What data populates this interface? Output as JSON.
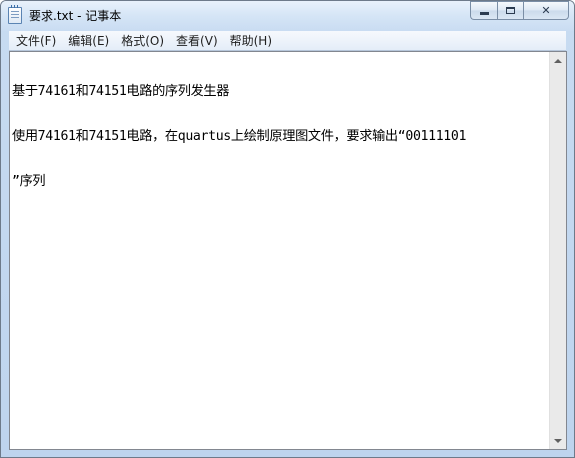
{
  "window": {
    "title": "要求.txt - 记事本",
    "icon": "notepad-icon",
    "controls": {
      "minimize": "minimize-icon",
      "maximize": "maximize-icon",
      "close": "close-icon",
      "close_glyph": "✕"
    }
  },
  "menu": {
    "items": [
      {
        "label": "文件(F)"
      },
      {
        "label": "编辑(E)"
      },
      {
        "label": "格式(O)"
      },
      {
        "label": "查看(V)"
      },
      {
        "label": "帮助(H)"
      }
    ]
  },
  "document": {
    "lines": [
      "基于74161和74151电路的序列发生器",
      "使用74161和74151电路，在quartus上绘制原理图文件，要求输出“00111101",
      "”序列"
    ]
  },
  "scrollbar": {
    "up_icon": "scroll-up-arrow-icon",
    "down_icon": "scroll-down-arrow-icon"
  }
}
